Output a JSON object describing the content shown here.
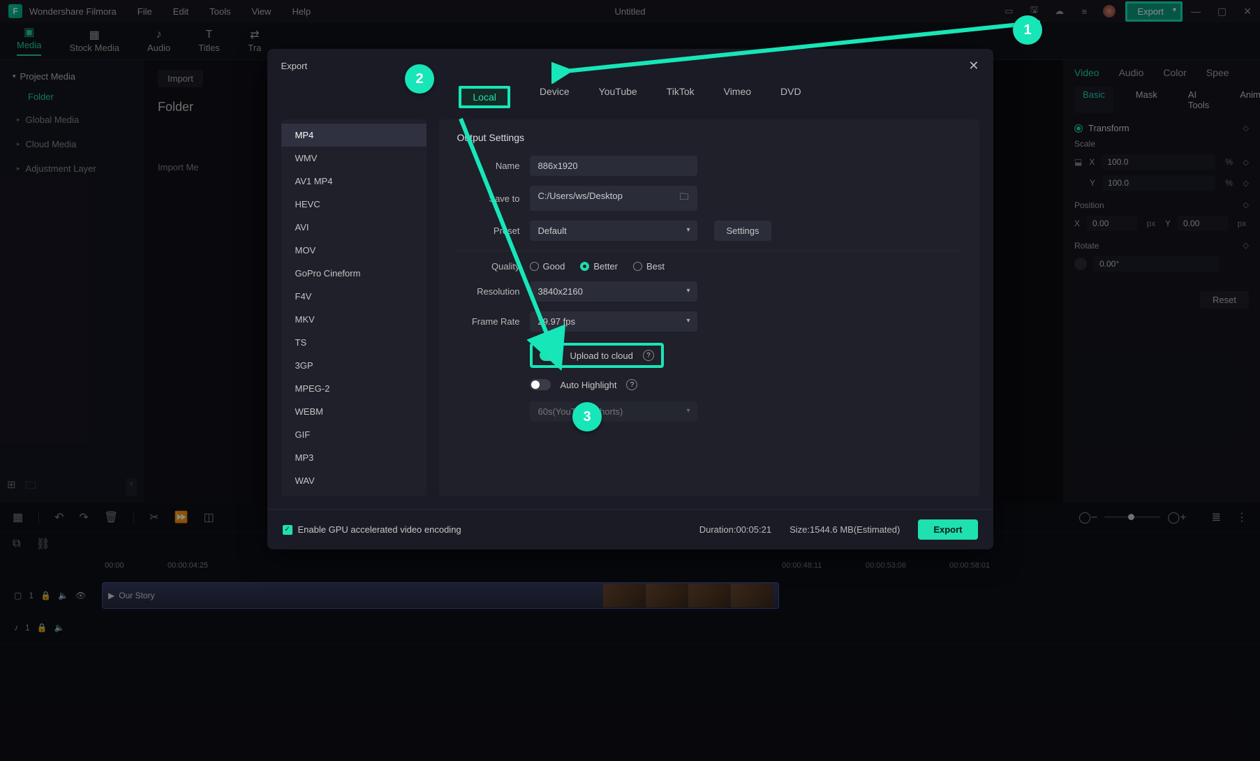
{
  "titlebar": {
    "app_name": "Wondershare Filmora",
    "menus": [
      "File",
      "Edit",
      "Tools",
      "View",
      "Help"
    ],
    "document": "Untitled",
    "export_label": "Export"
  },
  "main_tabs": {
    "items": [
      "Media",
      "Stock Media",
      "Audio",
      "Titles",
      "Tra"
    ],
    "active": "Media"
  },
  "sidebar": {
    "header": "Project Media",
    "folder": "Folder",
    "items": [
      "Global Media",
      "Cloud Media",
      "Adjustment Layer"
    ]
  },
  "center": {
    "import_button": "Import",
    "folder_title": "Folder",
    "import_hint": "Import Me"
  },
  "inspector": {
    "top_tabs": [
      "Video",
      "Audio",
      "Color",
      "Spee"
    ],
    "sub_tabs": [
      "Basic",
      "Mask",
      "AI Tools",
      "Anima"
    ],
    "transform_label": "Transform",
    "scale_label": "Scale",
    "x_label": "X",
    "y_label": "Y",
    "x_val": "100.0",
    "y_val": "100.0",
    "pct": "%",
    "position_label": "Position",
    "pos_x": "0.00",
    "pos_y": "0.00",
    "px": "px",
    "rotate_label": "Rotate",
    "rotate_val": "0.00°",
    "reset_label": "Reset"
  },
  "timeline": {
    "times": [
      "00:00",
      "00:00:04:25",
      "00:00:48:11",
      "00:00:53:06",
      "00:00:58:01"
    ],
    "clip_name": "Our Story",
    "track_v": "1",
    "track_a": "1"
  },
  "modal": {
    "title": "Export",
    "tabs": [
      "Local",
      "Device",
      "YouTube",
      "TikTok",
      "Vimeo",
      "DVD"
    ],
    "formats": [
      "MP4",
      "WMV",
      "AV1 MP4",
      "HEVC",
      "AVI",
      "MOV",
      "GoPro Cineform",
      "F4V",
      "MKV",
      "TS",
      "3GP",
      "MPEG-2",
      "WEBM",
      "GIF",
      "MP3",
      "WAV"
    ],
    "output_settings": "Output Settings",
    "name_label": "Name",
    "name_value": "886x1920",
    "save_label": "Save to",
    "save_value": "C:/Users/ws/Desktop",
    "preset_label": "Preset",
    "preset_value": "Default",
    "settings_btn": "Settings",
    "quality_label": "Quality",
    "q_good": "Good",
    "q_better": "Better",
    "q_best": "Best",
    "resolution_label": "Resolution",
    "resolution_value": "3840x2160",
    "framerate_label": "Frame Rate",
    "framerate_value": "29.97 fps",
    "upload_cloud": "Upload to cloud",
    "auto_highlight": "Auto Highlight",
    "shorts_value": "60s(YouTube Shorts)",
    "gpu_label": "Enable GPU accelerated video encoding",
    "duration_label": "Duration:",
    "duration_value": "00:05:21",
    "size_label": "Size:",
    "size_value": "1544.6 MB(Estimated)",
    "export_btn": "Export"
  },
  "annotations": {
    "n1": "1",
    "n2": "2",
    "n3": "3"
  }
}
